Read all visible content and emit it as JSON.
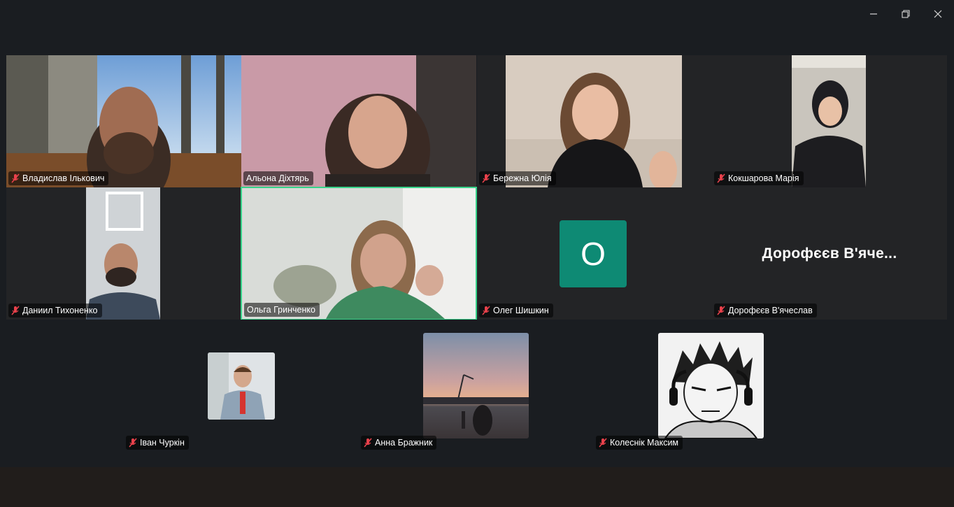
{
  "window": {
    "minimize_icon": "minimize-icon",
    "restore_icon": "restore-icon",
    "close_icon": "close-icon"
  },
  "colors": {
    "background": "#1a1d21",
    "active_speaker_border": "#37d38a",
    "muted_mic": "#e8414b",
    "avatar_bg": "#0e8a74"
  },
  "participants": [
    {
      "name": "Владислав Ількович",
      "muted": true
    },
    {
      "name": "Альона Діхтярь",
      "muted": false
    },
    {
      "name": "Бережна Юлія",
      "muted": true
    },
    {
      "name": "Кокшарова Марія",
      "muted": true
    },
    {
      "name": "Даниил Тихоненко",
      "muted": true
    },
    {
      "name": "Ольга Гринченко",
      "muted": false,
      "active_speaker": true
    },
    {
      "name": "Олег Шишкин",
      "muted": true,
      "avatar_letter": "О"
    },
    {
      "name": "Дорофєєв В'ячеслав",
      "muted": true,
      "display_name": "Дорофєєв В'яче..."
    },
    {
      "name": "Іван Чуркін",
      "muted": true
    },
    {
      "name": "Анна Бражник",
      "muted": true
    },
    {
      "name": "Колеснік Максим",
      "muted": true
    }
  ]
}
